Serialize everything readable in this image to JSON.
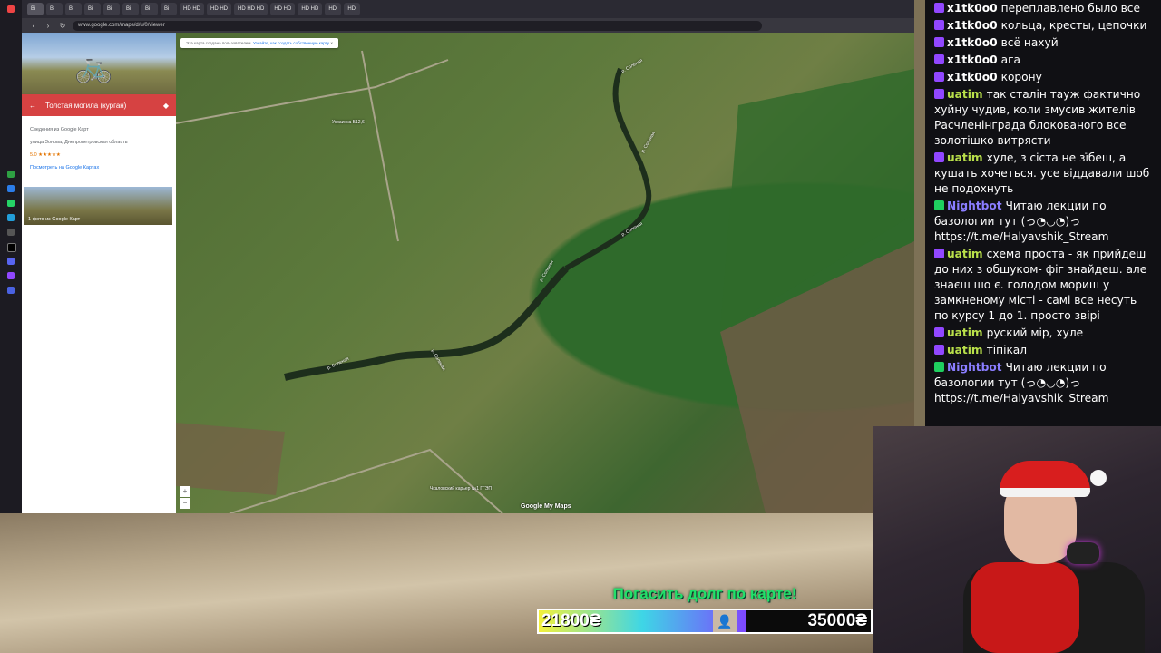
{
  "browser": {
    "tabs": [
      "Bi",
      "Bi",
      "Bi",
      "Bi",
      "Bi",
      "Bi",
      "Bi",
      "Bi",
      "HD HD",
      "HD HD",
      "HD HD HD",
      "HD HD",
      "HD HD",
      "HD",
      "HD"
    ],
    "url": "www.google.com/maps/d/u/0/viewer"
  },
  "sidepanel": {
    "place_title": "Толстая могила (курган)",
    "source_label": "Сведения из Google Карт",
    "address": "улица Зонова, Днепропетровская область",
    "rating": "5.0 ★★★★★",
    "maps_link": "Посмотреть на Google Картах",
    "photo_caption": "1 фото из Google Карт"
  },
  "map": {
    "notice_text": "Эта карта создана пользователем.",
    "notice_link": "Узнайте, как создать собственную карту",
    "labels": [
      "Украинка Б12,6",
      "р. Соленая",
      "р. Соленая",
      "р. Соленая",
      "р. Соленая",
      "р. Соленая",
      "р. Соленая",
      "Чкаловский карьер №1 ГГЭП"
    ],
    "zoom_in": "+",
    "zoom_out": "−",
    "watermark": "Google My Maps"
  },
  "overlay": {
    "goal_title": "Погасить долг по карте!",
    "goal_current": "21800₴",
    "goal_max": "35000₴",
    "goal_progress": 0.623
  },
  "chat": [
    {
      "user": "x1tk0o0",
      "color": "#ffffff",
      "text": "переплавлено было все",
      "badge": "purple"
    },
    {
      "user": "x1tk0o0",
      "color": "#ffffff",
      "text": "кольца, кресты, цепочки",
      "badge": "purple"
    },
    {
      "user": "x1tk0o0",
      "color": "#ffffff",
      "text": "всё нахуй",
      "badge": "purple"
    },
    {
      "user": "x1tk0o0",
      "color": "#ffffff",
      "text": "ага",
      "badge": "purple"
    },
    {
      "user": "x1tk0o0",
      "color": "#ffffff",
      "text": "корону",
      "badge": "purple"
    },
    {
      "user": "uatim",
      "color": "#b9e04a",
      "text": "так сталін тауж фактично хуйну чудив, коли змусив жителів Расчленінграда блокованого все золотішко витрясти",
      "badge": "purple"
    },
    {
      "user": "uatim",
      "color": "#b9e04a",
      "text": "хуле, з сіста не зїбеш, а кушать хочеться. усе віддавали шоб не подохнуть",
      "badge": "purple"
    },
    {
      "user": "Nightbot",
      "color": "#8a7dff",
      "text": "Читаю лекции по базологии тут (っ◔◡◔)っ https://t.me/Halyavshik_Stream",
      "badge": "bot"
    },
    {
      "user": "uatim",
      "color": "#b9e04a",
      "text": "схема проста - як прийдеш до них з обшуком- фіг знайдеш. але знаєш шо є. голодом мориш у замкненому місті - самі все несуть по курсу 1 до 1. просто звірі",
      "badge": "purple"
    },
    {
      "user": "uatim",
      "color": "#b9e04a",
      "text": "руский мір, хуле",
      "badge": "purple"
    },
    {
      "user": "uatim",
      "color": "#b9e04a",
      "text": "тіпікал",
      "badge": "purple"
    },
    {
      "user": "Nightbot",
      "color": "#8a7dff",
      "text": "Читаю лекции по базологии тут (っ◔◡◔)っ https://t.me/Halyavshik_Stream",
      "badge": "bot"
    }
  ]
}
